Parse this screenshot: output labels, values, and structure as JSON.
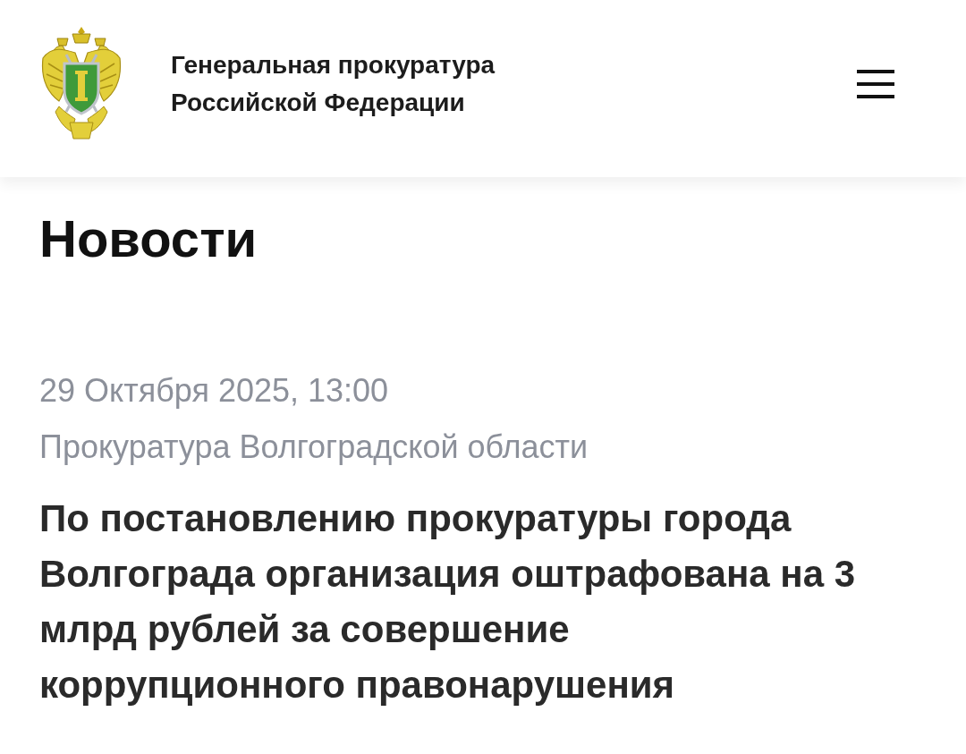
{
  "header": {
    "title": "Генеральная прокуратура\nРоссийской Федерации"
  },
  "page_title": "Новости",
  "article": {
    "date": "29 Октября 2025, 13:00",
    "source": "Прокуратура Волгоградской области",
    "headline": "По постановлению прокуратуры города Волгограда организация оштрафована на 3 млрд рублей за совершение коррупционного правонарушения"
  }
}
